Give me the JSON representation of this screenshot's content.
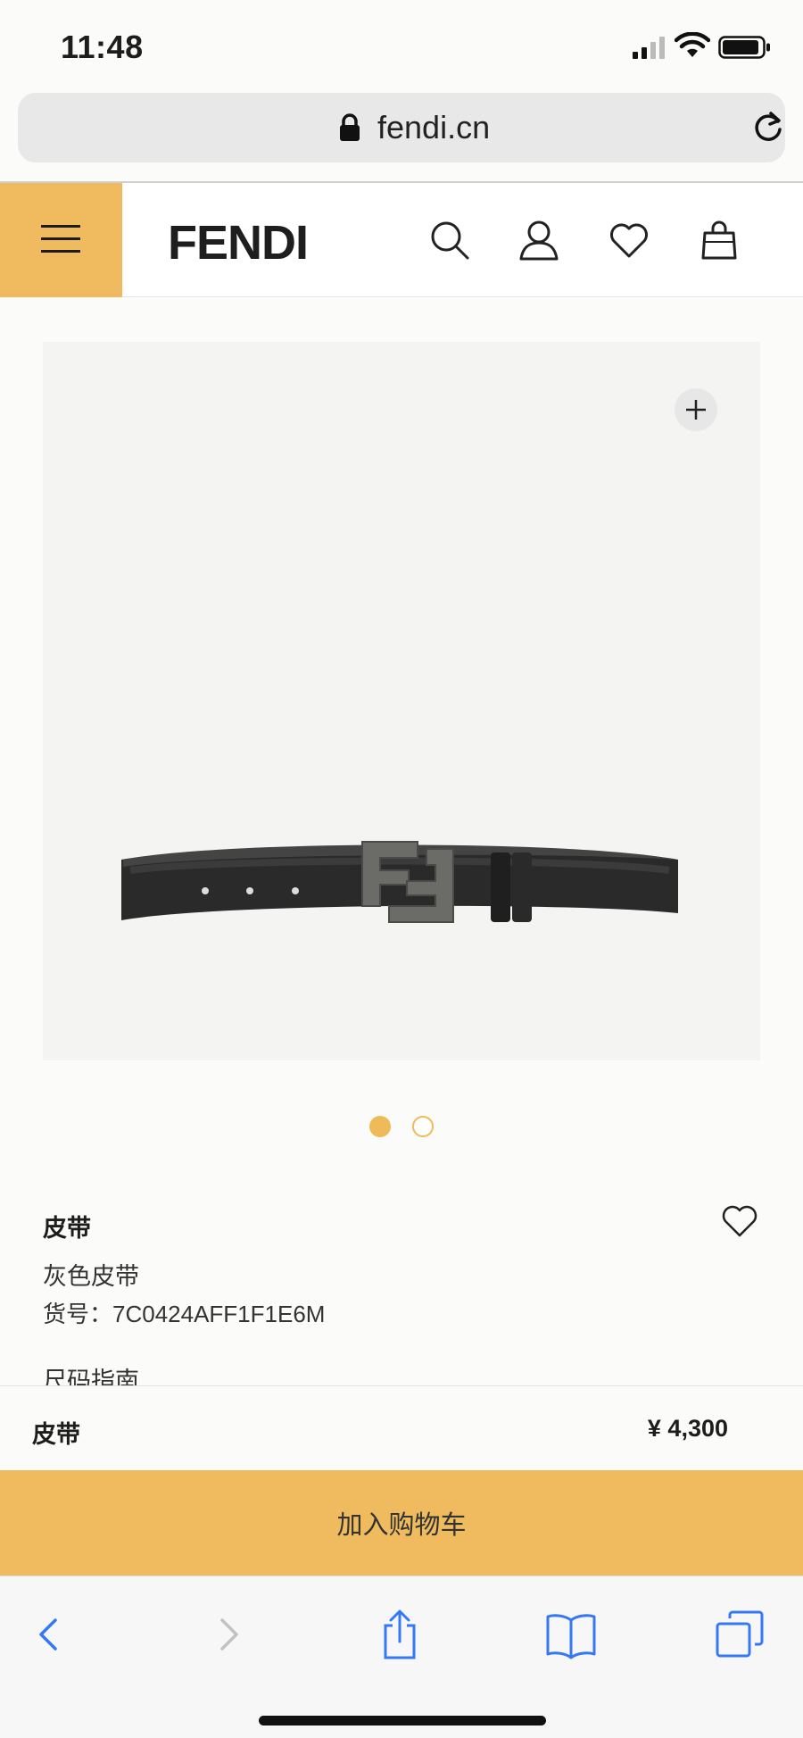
{
  "status_bar": {
    "time": "11:48"
  },
  "browser": {
    "url": "fendi.cn"
  },
  "header": {
    "logo": "FENDI"
  },
  "product": {
    "category": "皮带",
    "name": "灰色皮带",
    "sku": "货号：7C0424AFF1F1E6M",
    "size_guide": "尺码指南",
    "image_count": 2,
    "active_image": 1
  },
  "sticky_bar": {
    "category": "皮带",
    "price": "¥  4,300"
  },
  "cart": {
    "add_label": "加入购物车"
  },
  "colors": {
    "accent": "#f0bb5e",
    "safari_blue": "#3478f6"
  },
  "icons": [
    "menu-icon",
    "search-icon",
    "account-icon",
    "wishlist-icon",
    "bag-icon",
    "zoom-plus-icon",
    "heart-icon",
    "back-icon",
    "forward-icon",
    "share-icon",
    "bookmarks-icon",
    "tabs-icon",
    "lock-icon",
    "reload-icon"
  ]
}
